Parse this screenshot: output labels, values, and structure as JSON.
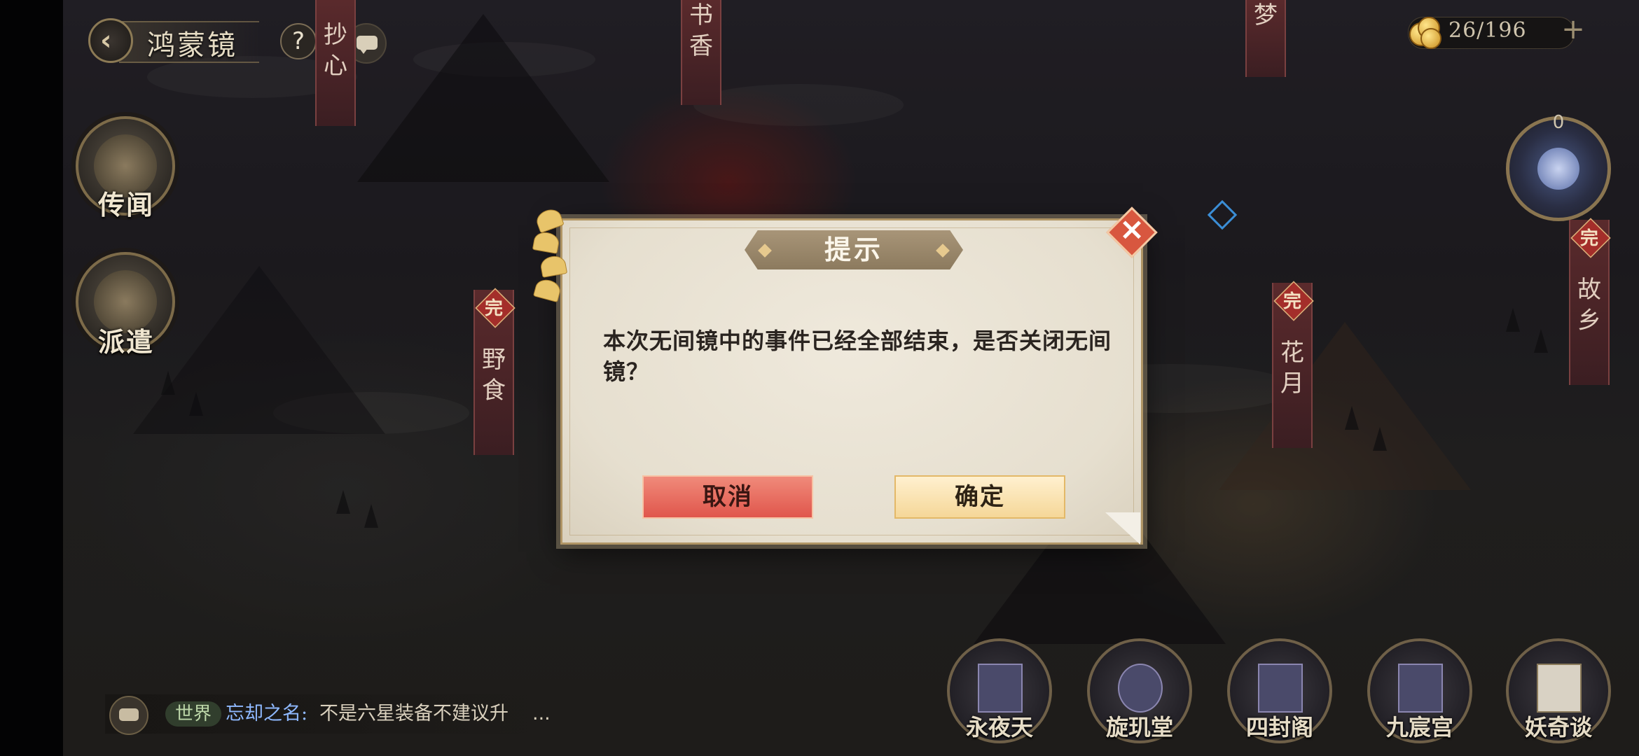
{
  "header": {
    "title": "鸿蒙镜",
    "back_icon": "back-arrow-icon",
    "help_label": "?"
  },
  "currency": {
    "value": "26/196",
    "add_label": "+",
    "icon": "coin-icon"
  },
  "left_menu": [
    {
      "label": "传闻",
      "icon": "dragon-icon"
    },
    {
      "label": "派遣",
      "icon": "dispatch-icon"
    }
  ],
  "right_menu": {
    "count": "0",
    "icon": "spirit-orb-icon"
  },
  "map_banners": [
    {
      "text": "抄心",
      "done": false
    },
    {
      "text": "书香",
      "done": false
    },
    {
      "text": "梦",
      "done": false
    },
    {
      "text": "野食",
      "done": true
    },
    {
      "text": "花月",
      "done": true
    },
    {
      "text": "故乡",
      "done": true
    }
  ],
  "done_badge": "完",
  "dialog": {
    "title": "提示",
    "message": "本次无间镜中的事件已经全部结束，是否关闭无间镜？",
    "cancel_label": "取消",
    "confirm_label": "确定",
    "close_icon": "close-x-icon"
  },
  "chat": {
    "channel": "世界",
    "sender": "忘却之名:",
    "message": "不是六星装备不建议升",
    "more": "..."
  },
  "bottom_menu": [
    {
      "label": "永夜天"
    },
    {
      "label": "旋玑堂"
    },
    {
      "label": "四封阁"
    },
    {
      "label": "九宸宫"
    },
    {
      "label": "妖奇谈"
    }
  ],
  "colors": {
    "cancel": "#e0564c",
    "confirm": "#f5d798",
    "dialog_bg": "#e6dfcf",
    "accent_gold": "#b09565"
  }
}
